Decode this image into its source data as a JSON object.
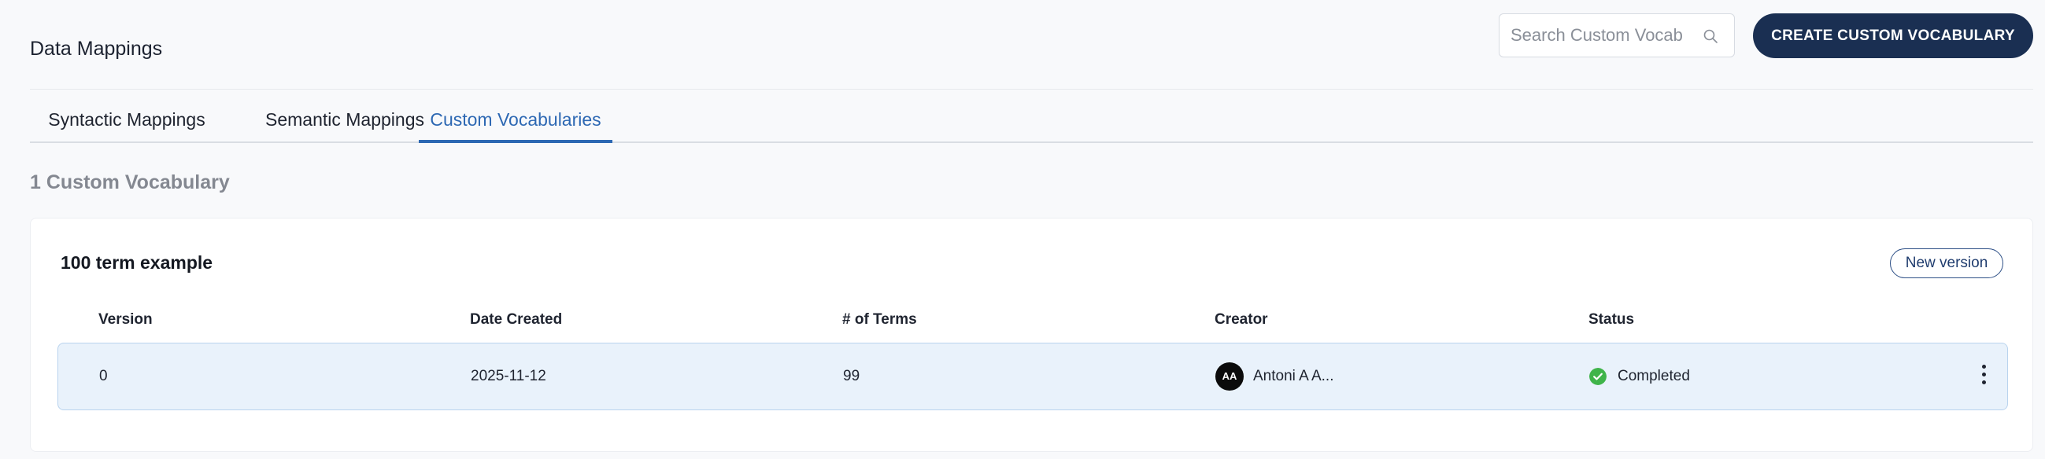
{
  "header": {
    "title": "Data Mappings",
    "search_placeholder": "Search Custom Vocab",
    "create_button_label": "CREATE CUSTOM VOCABULARY"
  },
  "tabs": [
    {
      "label": "Syntactic Mappings",
      "active": false
    },
    {
      "label": "Semantic Mappings",
      "active": false
    },
    {
      "label": "Custom Vocabularies",
      "active": true
    }
  ],
  "count_heading": "1 Custom Vocabulary",
  "card": {
    "title": "100 term example",
    "new_version_label": "New version",
    "columns": [
      "Version",
      "Date Created",
      "# of Terms",
      "Creator",
      "Status"
    ],
    "rows": [
      {
        "version": "0",
        "date_created": "2025-11-12",
        "terms": "99",
        "creator_initials": "AA",
        "creator_name": "Antoni A A...",
        "status": "Completed"
      }
    ]
  },
  "colors": {
    "primary_button": "#1a2f52",
    "active_tab": "#2d68b3",
    "row_highlight": "#e9f2fb",
    "status_success": "#3fb44a"
  },
  "icons": [
    "search-icon",
    "check-circle-icon",
    "more-vertical-icon"
  ]
}
